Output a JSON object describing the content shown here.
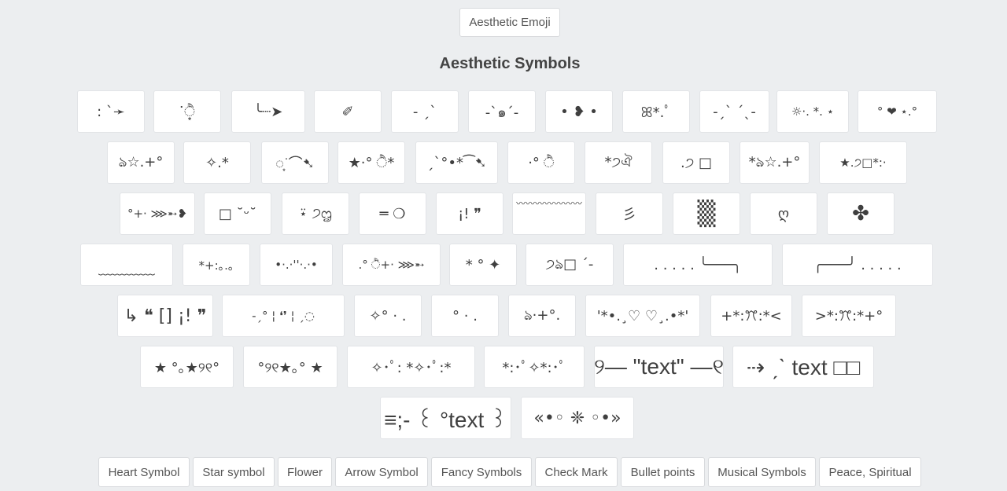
{
  "header": {
    "emoji_button": "Aesthetic Emoji",
    "title": "Aesthetic Symbols"
  },
  "symbols": [
    ": ˋ➛",
    "˙ੈ͙",
    "╰┈➤",
    "✐",
    "- ˏˋ",
    "-ˋ๑ˊ-",
    "• ❥ •",
    "ꕤ*.ﾟ",
    "-ˏˋ ˊˎ-",
    "☼·. *. ⋆",
    "° ❤︎ ⋆.°",
    "ঌ☆.+°",
    "✧.*",
    "◌͙͘ ⌒➷",
    "★·° ੈ*",
    "ˏˋ°•*⁀➷",
    "·° ੈ",
    "*੭ঐ",
    ".੭ □",
    "*ঌ☆.+°",
    "★.੭□*:·",
    "°+· ⋙➵❥",
    "□ ˘ᵕ˘",
    "⍣ ੭ᦗ",
    "═ ❍",
    "¡! ❞",
    "〰〰〰〰〰〰〰",
    "彡",
    "▒",
    "ღ",
    "✤",
    "﹏﹏﹏﹏",
    "*+:｡.｡",
    "•·.·''·.·•",
    ".° ੈ+· ⋙➵",
    "* ° ✦",
    "੭ঌ□ ˊ-",
    ". . . . .  ╰───╮",
    "╭───╯  . . . . .",
    "↳ ❝ [] ¡! ❞",
    "-ˏ° ¦ ❛❜ ¦ ˏ◌",
    "✧° · .",
    "° · .",
    "ঌ·+°.",
    "'*•.¸♡ ♡¸.•*'",
    "+*:ꔫ:*<",
    ">*:ꔫ:*+°",
    "★ °｡★୨୧°",
    "°୨୧★｡° ★",
    "✧･ﾟ: *✧･ﾟ:*",
    "*:･ﾟ✧*:･ﾟ",
    "୨— \"text\" —୧",
    "⇢ ˏˋ text □□",
    "≡;- ꒰ °text ꒱",
    "«•◦ ❈ ◦•»"
  ],
  "categories": [
    "Heart Symbol",
    "Star symbol",
    "Flower",
    "Arrow Symbol",
    "Fancy Symbols",
    "Check Mark",
    "Bullet points",
    "Musical Symbols",
    "Peace, Spiritual"
  ]
}
